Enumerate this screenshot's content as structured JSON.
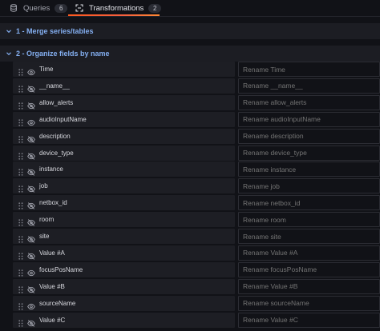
{
  "tabs": [
    {
      "label": "Queries",
      "count": "6",
      "icon": "database-icon"
    },
    {
      "label": "Transformations",
      "count": "2",
      "icon": "transform-icon",
      "active": true
    }
  ],
  "transformations": [
    {
      "title": "1 - Merge series/tables",
      "expanded": false
    },
    {
      "title": "2 - Organize fields by name",
      "expanded": true
    }
  ],
  "fields": [
    {
      "name": "Time",
      "visible": true,
      "rename_placeholder": "Rename Time"
    },
    {
      "name": "__name__",
      "visible": false,
      "rename_placeholder": "Rename __name__"
    },
    {
      "name": "allow_alerts",
      "visible": false,
      "rename_placeholder": "Rename allow_alerts"
    },
    {
      "name": "audioInputName",
      "visible": true,
      "rename_placeholder": "Rename audioInputName"
    },
    {
      "name": "description",
      "visible": false,
      "rename_placeholder": "Rename description"
    },
    {
      "name": "device_type",
      "visible": false,
      "rename_placeholder": "Rename device_type"
    },
    {
      "name": "instance",
      "visible": false,
      "rename_placeholder": "Rename instance"
    },
    {
      "name": "job",
      "visible": false,
      "rename_placeholder": "Rename job"
    },
    {
      "name": "netbox_id",
      "visible": false,
      "rename_placeholder": "Rename netbox_id"
    },
    {
      "name": "room",
      "visible": false,
      "rename_placeholder": "Rename room"
    },
    {
      "name": "site",
      "visible": false,
      "rename_placeholder": "Rename site"
    },
    {
      "name": "Value #A",
      "visible": false,
      "rename_placeholder": "Rename Value #A"
    },
    {
      "name": "focusPosName",
      "visible": true,
      "rename_placeholder": "Rename focusPosName"
    },
    {
      "name": "Value #B",
      "visible": false,
      "rename_placeholder": "Rename Value #B"
    },
    {
      "name": "sourceName",
      "visible": true,
      "rename_placeholder": "Rename sourceName"
    },
    {
      "name": "Value #C",
      "visible": false,
      "rename_placeholder": "Rename Value #C"
    }
  ],
  "colors": {
    "background": "#111217",
    "section_title": "#84aff1",
    "tab_underline": "#f55f3e"
  }
}
